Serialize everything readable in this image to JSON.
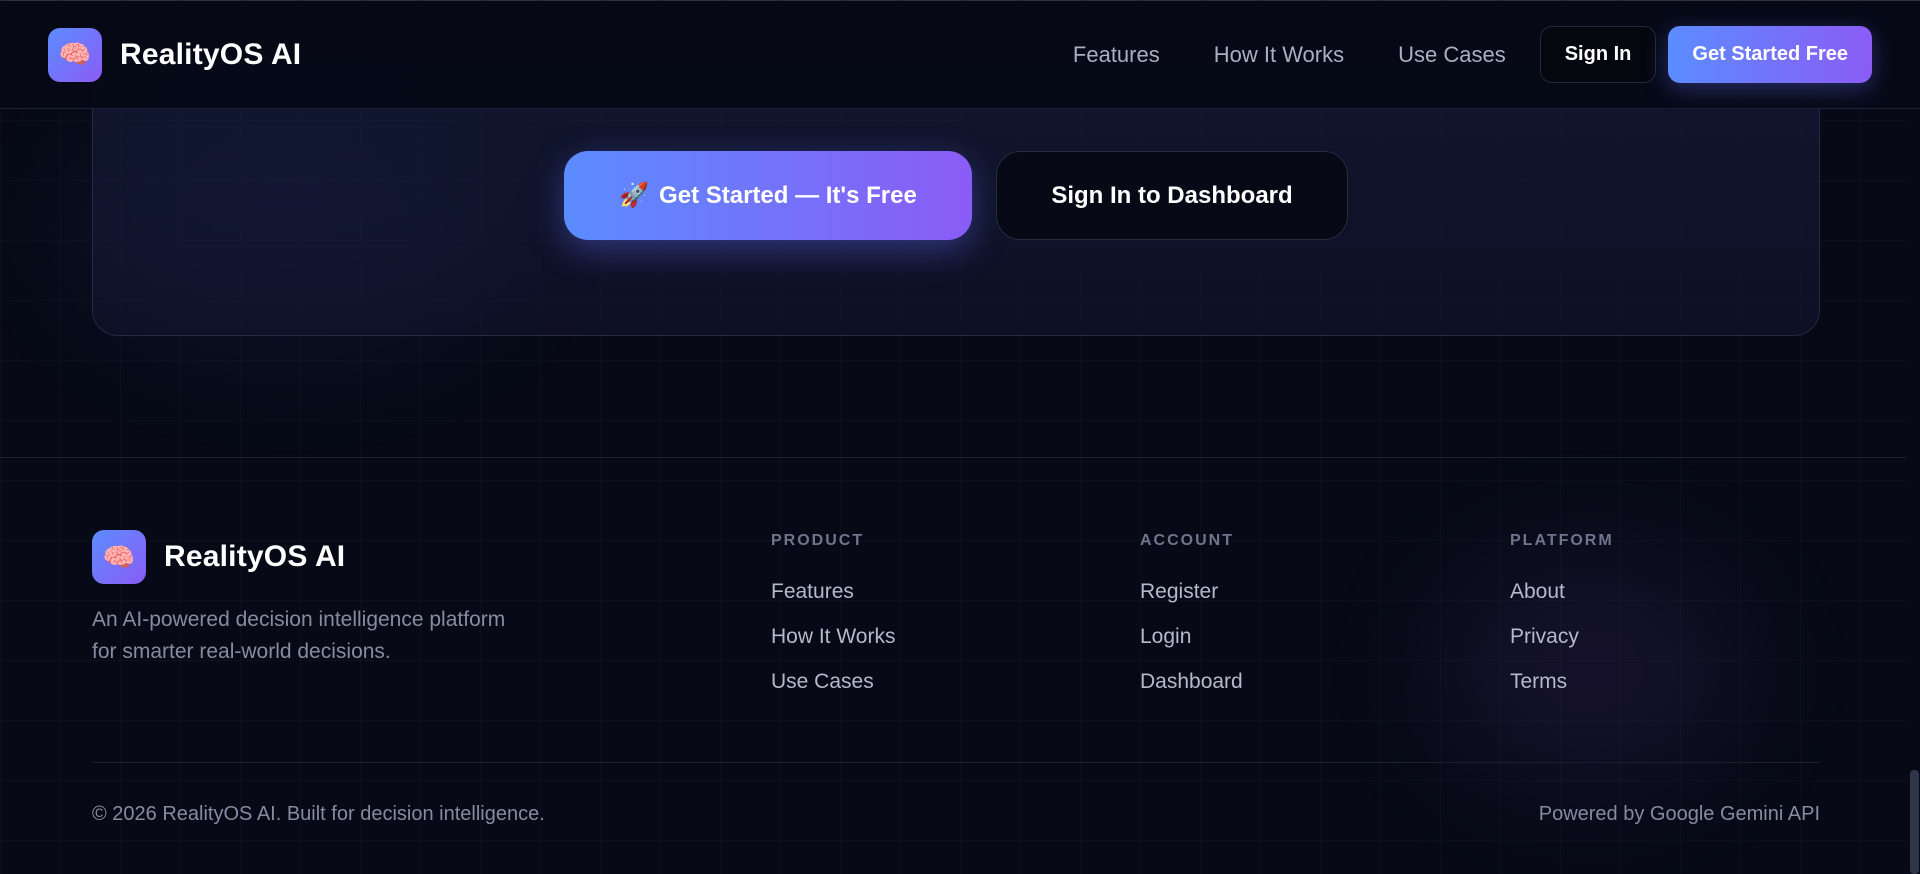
{
  "header": {
    "logo_icon": "brain-icon",
    "brand": "RealityOS AI",
    "nav": [
      "Features",
      "How It Works",
      "Use Cases"
    ],
    "sign_in": "Sign In",
    "get_started": "Get Started Free"
  },
  "cta": {
    "primary_emoji": "🚀",
    "primary_label": "Get Started — It's Free",
    "secondary_label": "Sign In to Dashboard"
  },
  "footer": {
    "brand": "RealityOS AI",
    "description": "An AI-powered decision intelligence platform for smarter real-world decisions.",
    "columns": [
      {
        "title": "PRODUCT",
        "links": [
          "Features",
          "How It Works",
          "Use Cases"
        ]
      },
      {
        "title": "ACCOUNT",
        "links": [
          "Register",
          "Login",
          "Dashboard"
        ]
      },
      {
        "title": "PLATFORM",
        "links": [
          "About",
          "Privacy",
          "Terms"
        ]
      }
    ],
    "copyright": "© 2026 RealityOS AI. Built for decision intelligence.",
    "powered_by": "Powered by Google Gemini API"
  },
  "colors": {
    "background": "#070a16",
    "accent_start": "#5b8cff",
    "accent_end": "#8b5cf6"
  }
}
